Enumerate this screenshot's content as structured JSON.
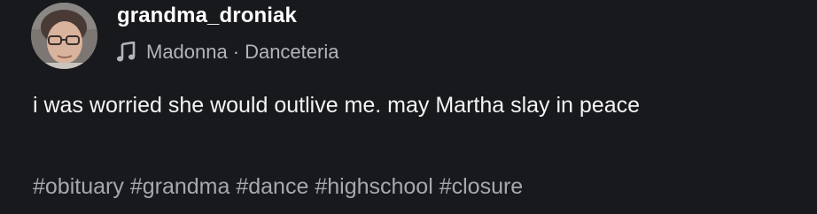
{
  "post": {
    "username": "grandma_droniak",
    "music": {
      "icon": "music-note-icon",
      "artist": "Madonna",
      "separator": "·",
      "song": "Danceteria"
    },
    "caption": "i was worried she would outlive me. may Martha slay in peace",
    "hashtags": [
      "#obituary",
      "#grandma",
      "#dance",
      "#highschool",
      "#closure"
    ]
  },
  "colors": {
    "background": "#18191d",
    "username": "#ffffff",
    "secondary_text": "#b3b4b8",
    "hashtags": "#a7a8ad"
  }
}
